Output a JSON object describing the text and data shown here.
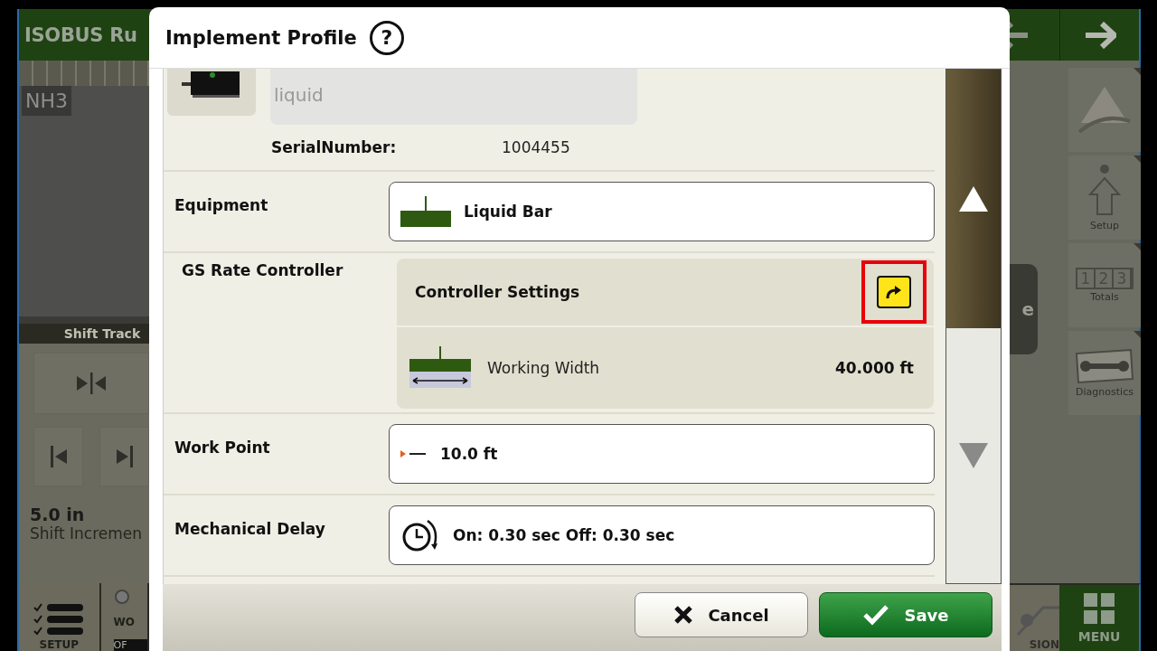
{
  "background_app": {
    "title": "ISOBUS Ru",
    "product_label": "NH3",
    "shift_track": {
      "title": "Shift Track",
      "value": "5.0 in",
      "label": "Shift Incremen"
    },
    "side_buttons": [
      {
        "kind": "logo"
      },
      {
        "kind": "setup",
        "label": "Setup"
      },
      {
        "kind": "totals",
        "label": "Totals"
      },
      {
        "kind": "diagnostics",
        "label": "Diagnostics"
      }
    ],
    "totals_digits": [
      "1",
      "2",
      "3"
    ],
    "partial_button": "e",
    "bottom_tabs": [
      {
        "kind": "setup",
        "label": "SETUP"
      },
      {
        "kind": "work",
        "label": "WO",
        "sublabel": "OF"
      }
    ],
    "partial_tab": "SION",
    "menu": "MENU"
  },
  "dialog": {
    "title": "Implement Profile",
    "help": "?",
    "name_field": {
      "value": "liquid",
      "disabled": true
    },
    "serial": {
      "label": "SerialNumber:",
      "value": "1004455"
    },
    "rows": [
      {
        "kind": "equipment",
        "label": "Equipment",
        "value": "Liquid Bar"
      },
      {
        "kind": "controller",
        "label": "GS Rate Controller",
        "panel_title": "Controller Settings",
        "highlighted": true,
        "item_label": "Working Width",
        "item_value": "40.000 ft"
      },
      {
        "kind": "work_point",
        "label": "Work Point",
        "value": "10.0 ft"
      },
      {
        "kind": "delay",
        "label": "Mechanical Delay",
        "value": "On: 0.30 sec Off: 0.30 sec"
      }
    ],
    "scroll_up": {
      "disabled": false
    },
    "scroll_down": {
      "disabled": true
    },
    "buttons": [
      {
        "kind": "cancel",
        "label": "Cancel"
      },
      {
        "kind": "save",
        "label": "Save"
      }
    ]
  }
}
